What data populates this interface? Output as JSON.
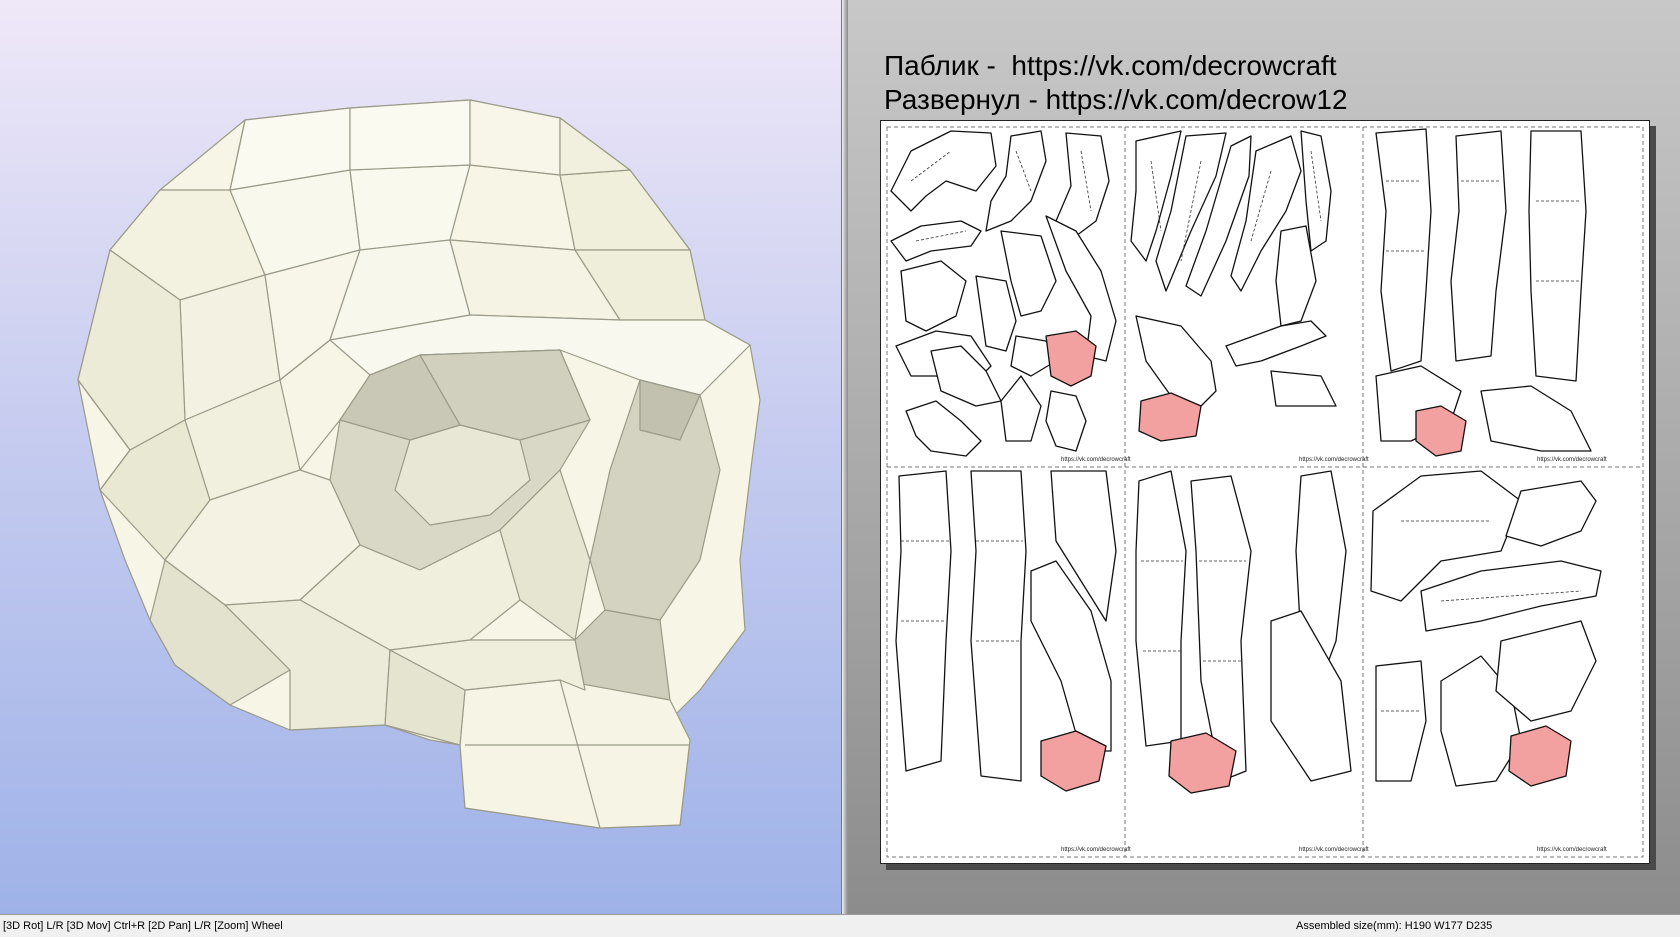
{
  "notes": {
    "line1": "Паблик -  https://vk.com/decrowcraft",
    "line2": "Развернул - https://vk.com/decrow12"
  },
  "sheet": {
    "footer_label": "https://vk.com/decrowcraft"
  },
  "status": {
    "left": "[3D Rot] L/R [3D Mov] Ctrl+R [2D Pan] L/R [Zoom] Wheel",
    "right": "Assembled size(mm): H190 W177 D235"
  },
  "colors": {
    "model_face": "#f7f6e6",
    "model_edge": "#9a9a88",
    "highlight": "#f07070"
  }
}
